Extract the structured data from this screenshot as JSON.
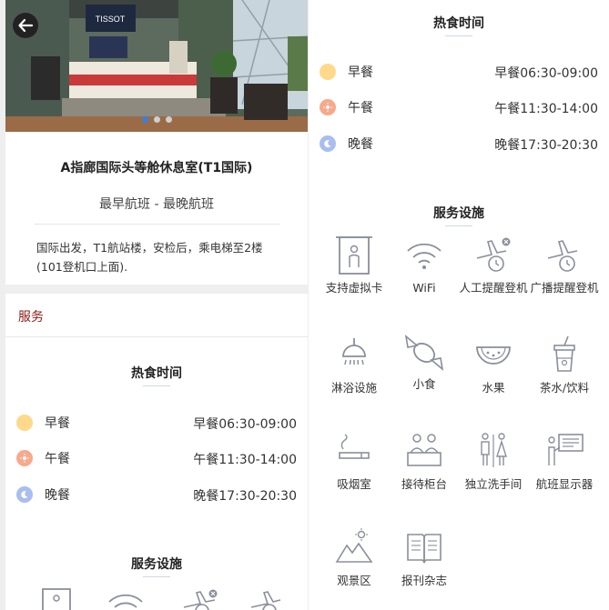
{
  "lounge": {
    "name": "A指廊国际头等舱休息室(T1国际)",
    "flights": "最早航班 - 最晚航班",
    "location": "国际出发，T1航站楼，安检后，乘电梯至2楼(101登机口上面)."
  },
  "hero": {
    "sign_text": "TISSOT",
    "slide_count": 3,
    "active_slide": 1
  },
  "services_tab": "服务",
  "hot_food": {
    "title": "热食时间",
    "meals": [
      {
        "label": "早餐",
        "time": "早餐06:30-09:00",
        "icon": "sunrise-icon",
        "color": "#ffd98a"
      },
      {
        "label": "午餐",
        "time": "午餐11:30-14:00",
        "icon": "sun-icon",
        "color": "#f7a98c"
      },
      {
        "label": "晚餐",
        "time": "晚餐17:30-20:30",
        "icon": "moon-icon",
        "color": "#a9bdf0"
      }
    ]
  },
  "facilities": {
    "title": "服务设施",
    "items": [
      {
        "label": "支持虚拟卡",
        "icon": "door-person-icon"
      },
      {
        "label": "WiFi",
        "icon": "wifi-icon"
      },
      {
        "label": "人工提醒登机",
        "icon": "plane-clock-x-icon"
      },
      {
        "label": "广播提醒登机",
        "icon": "plane-clock-icon"
      },
      {
        "label": "淋浴设施",
        "icon": "shower-icon"
      },
      {
        "label": "小食",
        "icon": "candy-icon"
      },
      {
        "label": "水果",
        "icon": "watermelon-icon"
      },
      {
        "label": "茶水/饮料",
        "icon": "drink-cup-icon"
      },
      {
        "label": "吸烟室",
        "icon": "cigarette-icon"
      },
      {
        "label": "接待柜台",
        "icon": "reception-icon"
      },
      {
        "label": "独立洗手间",
        "icon": "restroom-icon"
      },
      {
        "label": "航班显示器",
        "icon": "flight-display-icon"
      },
      {
        "label": "观景区",
        "icon": "mountain-view-icon"
      },
      {
        "label": "报刊杂志",
        "icon": "magazine-icon"
      }
    ]
  },
  "colors": {
    "accent": "#8b1a1a",
    "icon_stroke": "#8a8f9c",
    "slide_active": "#3b7ddd"
  }
}
